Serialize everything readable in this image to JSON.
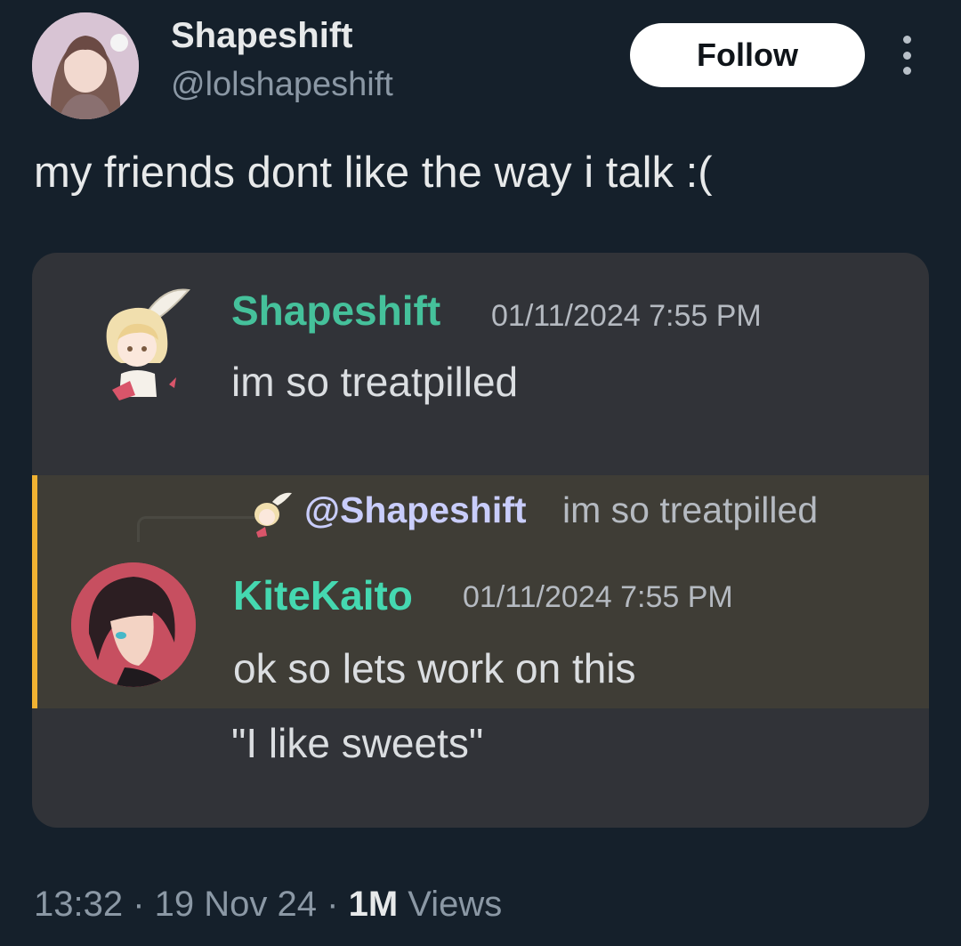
{
  "tweet": {
    "author_name": "Shapeshift",
    "author_handle": "@lolshapeshift",
    "follow_label": "Follow",
    "text": "my friends dont like the way i talk :("
  },
  "embedded_chat": {
    "message1": {
      "author": "Shapeshift",
      "timestamp": "01/11/2024 7:55 PM",
      "text": "im so treatpilled"
    },
    "reply_preview": {
      "mention": "@Shapeshift",
      "text": "im so treatpilled"
    },
    "message2": {
      "author": "KiteKaito",
      "timestamp": "01/11/2024 7:55 PM",
      "text": "ok so lets work on this"
    },
    "message3": {
      "text": "\"I like sweets\""
    },
    "colors": {
      "card_bg": "#313338",
      "highlight_bg": "#3f3d36",
      "highlight_bar": "#f0b232",
      "author1_color": "#45c19b",
      "author2_color": "#45d8b0"
    }
  },
  "footer": {
    "time": "13:32",
    "date": "19 Nov 24",
    "views_count": "1M",
    "views_label": "Views"
  },
  "icons": [
    "more-options-icon"
  ]
}
